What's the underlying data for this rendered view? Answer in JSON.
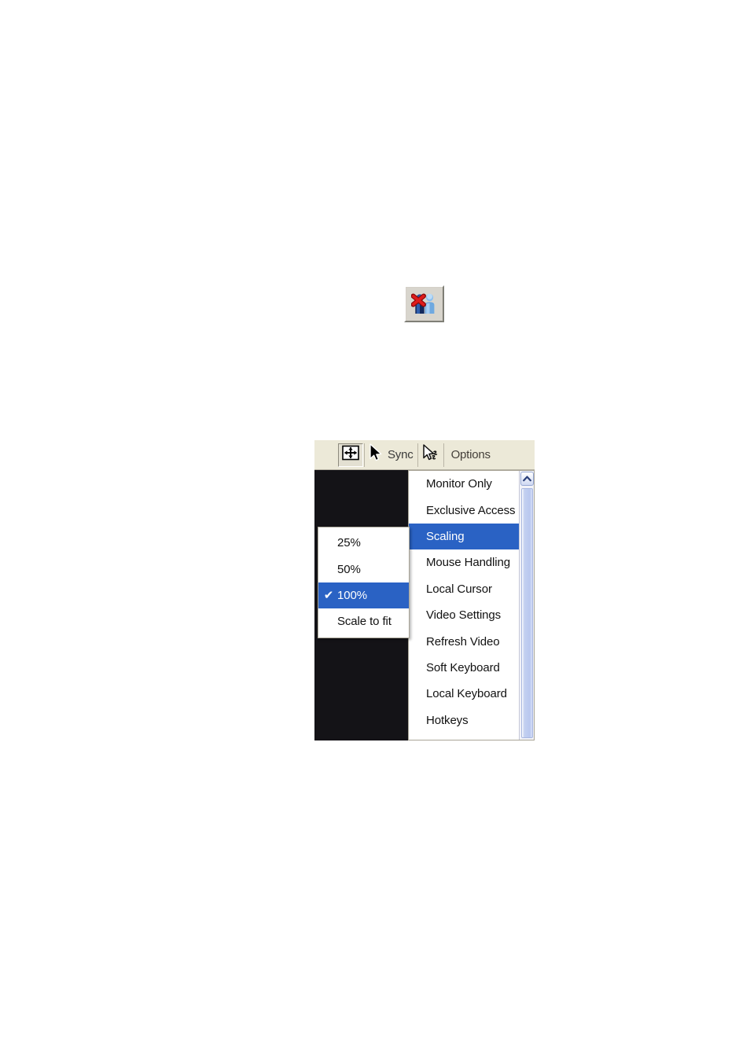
{
  "figure_disconnect": {
    "icon_name": "disconnect-user-icon",
    "tooltip": "",
    "colors": {
      "button_face": "#d8d5cd",
      "user_dark": "#1c3f86",
      "user_light": "#7fb4e8",
      "x_red": "#cc1111"
    }
  },
  "kvm": {
    "toolbar": {
      "scale_button_icon": "fit-to-screen-icon",
      "sync_cursor_icon": "mouse-pointer-icon",
      "sync_label": "Sync",
      "local_cursor_icon": "dual-mouse-pointer-icon",
      "options_label": "Options"
    },
    "video_area": {
      "background": "#141317"
    },
    "options_menu": {
      "items": [
        {
          "label": "Monitor Only",
          "selected": false
        },
        {
          "label": "Exclusive Access",
          "selected": false
        },
        {
          "label": "Scaling",
          "selected": true
        },
        {
          "label": "Mouse Handling",
          "selected": false
        },
        {
          "label": "Local Cursor",
          "selected": false
        },
        {
          "label": "Video Settings",
          "selected": false
        },
        {
          "label": "Refresh Video",
          "selected": false
        },
        {
          "label": "Soft Keyboard",
          "selected": false
        },
        {
          "label": "Local Keyboard",
          "selected": false
        },
        {
          "label": "Hotkeys",
          "selected": false
        }
      ],
      "scrollbar": {
        "up_arrow_icon": "chevron-up-icon",
        "thumb_visible": true
      }
    },
    "scaling_submenu": {
      "items": [
        {
          "label": "25%",
          "checked": false,
          "selected": false
        },
        {
          "label": "50%",
          "checked": false,
          "selected": false
        },
        {
          "label": "100%",
          "checked": true,
          "selected": true
        },
        {
          "label": "Scale to fit",
          "checked": false,
          "selected": false
        }
      ],
      "check_glyph": "✔"
    },
    "colors": {
      "toolbar_bg": "#ece9d8",
      "menu_bg": "#ffffff",
      "highlight": "#2a62c4",
      "highlight_text": "#ffffff",
      "menu_text": "#111111"
    }
  }
}
